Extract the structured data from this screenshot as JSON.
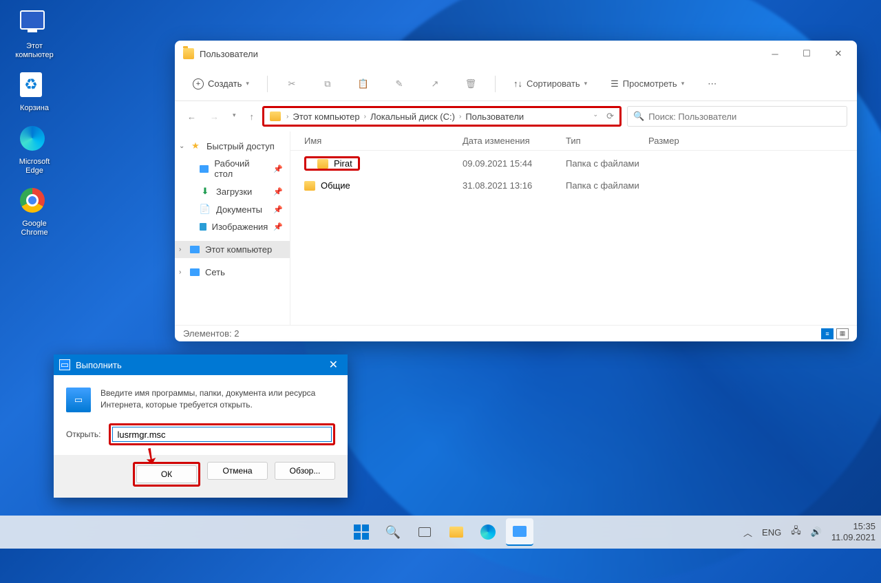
{
  "desktop": {
    "icons": [
      {
        "name": "this-pc",
        "label": "Этот\nкомпьютер"
      },
      {
        "name": "recycle-bin",
        "label": "Корзина"
      },
      {
        "name": "edge",
        "label": "Microsoft\nEdge"
      },
      {
        "name": "chrome",
        "label": "Google\nChrome"
      }
    ]
  },
  "explorer": {
    "title": "Пользователи",
    "toolbar": {
      "new_label": "Создать",
      "sort_label": "Сортировать",
      "view_label": "Просмотреть"
    },
    "breadcrumbs": [
      "Этот компьютер",
      "Локальный диск (C:)",
      "Пользователи"
    ],
    "search_placeholder": "Поиск: Пользователи",
    "columns": {
      "name": "Имя",
      "date": "Дата изменения",
      "type": "Тип",
      "size": "Размер"
    },
    "sidebar": {
      "quick_access": "Быстрый доступ",
      "desktop": "Рабочий стол",
      "downloads": "Загрузки",
      "documents": "Документы",
      "pictures": "Изображения",
      "this_pc": "Этот компьютер",
      "network": "Сеть"
    },
    "rows": [
      {
        "name": "Pirat",
        "date": "09.09.2021 15:44",
        "type": "Папка с файлами",
        "size": "",
        "highlighted": true
      },
      {
        "name": "Общие",
        "date": "31.08.2021 13:16",
        "type": "Папка с файлами",
        "size": ""
      }
    ],
    "status": "Элементов: 2"
  },
  "run": {
    "title": "Выполнить",
    "description": "Введите имя программы, папки, документа или ресурса Интернета, которые требуется открыть.",
    "open_label": "Открыть:",
    "input_value": "lusrmgr.msc",
    "ok": "ОК",
    "cancel": "Отмена",
    "browse": "Обзор..."
  },
  "taskbar": {
    "lang": "ENG",
    "time": "15:35",
    "date": "11.09.2021"
  }
}
